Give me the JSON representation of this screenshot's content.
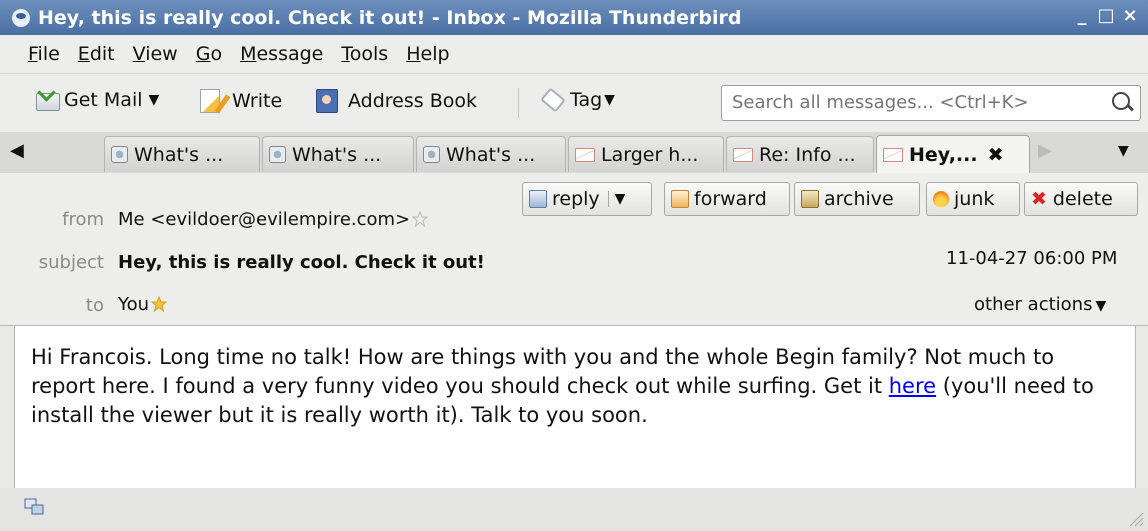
{
  "window": {
    "title": "Hey, this is really cool. Check it out! - Inbox - Mozilla Thunderbird",
    "controls": {
      "minimize": "_",
      "maximize": "□",
      "close": "×"
    }
  },
  "menu": {
    "items": [
      {
        "hot": "F",
        "rest": "ile"
      },
      {
        "hot": "E",
        "rest": "dit"
      },
      {
        "hot": "V",
        "rest": "iew"
      },
      {
        "hot": "G",
        "rest": "o"
      },
      {
        "hot": "M",
        "rest": "essage"
      },
      {
        "hot": "T",
        "rest": "ools"
      },
      {
        "hot": "H",
        "rest": "elp"
      }
    ]
  },
  "toolbar": {
    "get_mail": "Get Mail",
    "write": "Write",
    "address_book": "Address Book",
    "tag": "Tag",
    "search_placeholder": "Search all messages... <Ctrl+K>"
  },
  "tabs": [
    {
      "label": "What's ...",
      "icon": "message-icon"
    },
    {
      "label": "What's ...",
      "icon": "message-icon"
    },
    {
      "label": "What's ...",
      "icon": "message-icon"
    },
    {
      "label": "Larger h...",
      "icon": "envelope-icon"
    },
    {
      "label": "Re: Info ...",
      "icon": "envelope-icon"
    },
    {
      "label": "Hey,...",
      "icon": "envelope-icon",
      "active": true,
      "close": "✖"
    }
  ],
  "header": {
    "from_label": "from",
    "from_value": "Me <evildoer@evilempire.com>",
    "subject_label": "subject",
    "subject_value": "Hey, this is really cool. Check it out!",
    "to_label": "to",
    "to_value": "You",
    "date": "11-04-27 06:00 PM",
    "other_actions": "other actions",
    "buttons": {
      "reply": "reply",
      "forward": "forward",
      "archive": "archive",
      "junk": "junk",
      "delete": "delete"
    }
  },
  "body": {
    "text_before_link": "Hi Francois. Long time no talk! How are things with you and the whole Begin family? Not much to report here. I found a very funny video you should check out while surfing. Get it ",
    "link_text": "here",
    "text_after_link": " (you'll need to install the viewer but it is really worth it). Talk to you soon."
  },
  "colors": {
    "titlebar": "#4f74a8",
    "link": "#2a4fa4",
    "star": "#f3c33a"
  }
}
